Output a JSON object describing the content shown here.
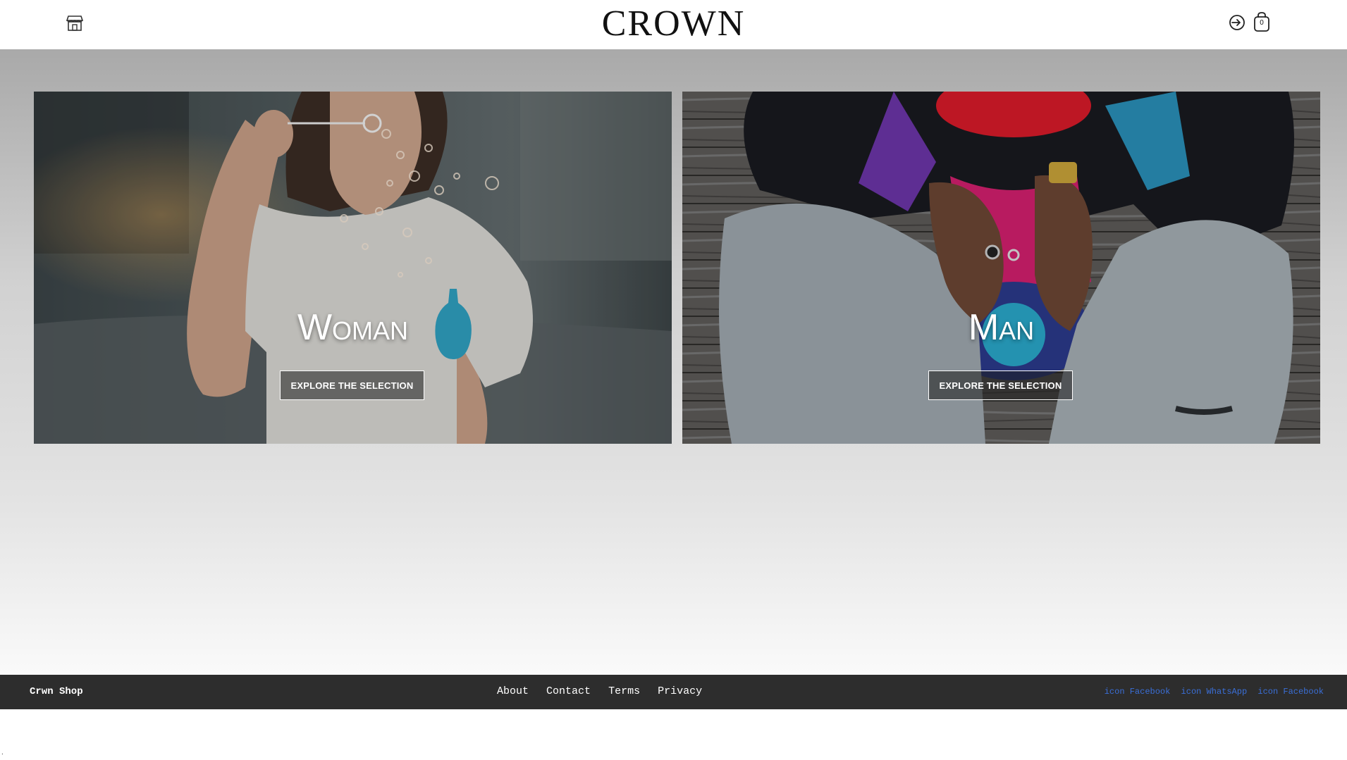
{
  "header": {
    "logo": "CROWN",
    "store_icon": "store-icon",
    "signin_icon": "sign-in-icon",
    "bag_icon": "shopping-bag-icon",
    "bag_count": "0"
  },
  "categories": [
    {
      "title": "Woman",
      "button_label": "EXPLORE THE SELECTION"
    },
    {
      "title": "Man",
      "button_label": "EXPLORE THE SELECTION"
    }
  ],
  "footer": {
    "brand": "Crwn Shop",
    "nav": [
      "About",
      "Contact",
      "Terms",
      "Privacy"
    ],
    "social": [
      "icon Facebook",
      "icon WhatsApp",
      "icon Facebook"
    ]
  },
  "corner_mark": "."
}
